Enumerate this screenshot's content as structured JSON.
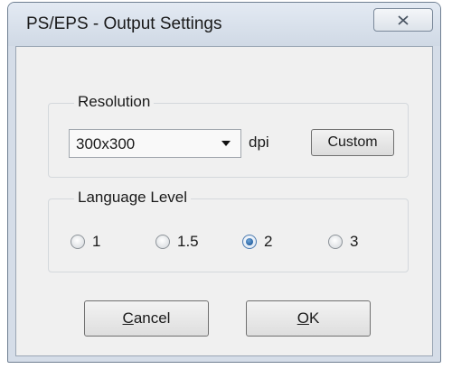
{
  "window": {
    "title": "PS/EPS - Output Settings",
    "close_icon": "close-icon"
  },
  "resolution": {
    "legend": "Resolution",
    "selected": "300x300",
    "unit": "dpi",
    "custom_label": "Custom"
  },
  "language_level": {
    "legend": "Language Level",
    "options": [
      {
        "label": "1",
        "checked": false
      },
      {
        "label": "1.5",
        "checked": false
      },
      {
        "label": "2",
        "checked": true
      },
      {
        "label": "3",
        "checked": false
      }
    ]
  },
  "buttons": {
    "cancel": {
      "mnemonic": "C",
      "rest": "ancel"
    },
    "ok": {
      "mnemonic": "O",
      "rest": "K"
    }
  },
  "colors": {
    "frame": "#d5dde8",
    "client": "#f0f0f0",
    "radio_selected": "#1f5a9a"
  }
}
